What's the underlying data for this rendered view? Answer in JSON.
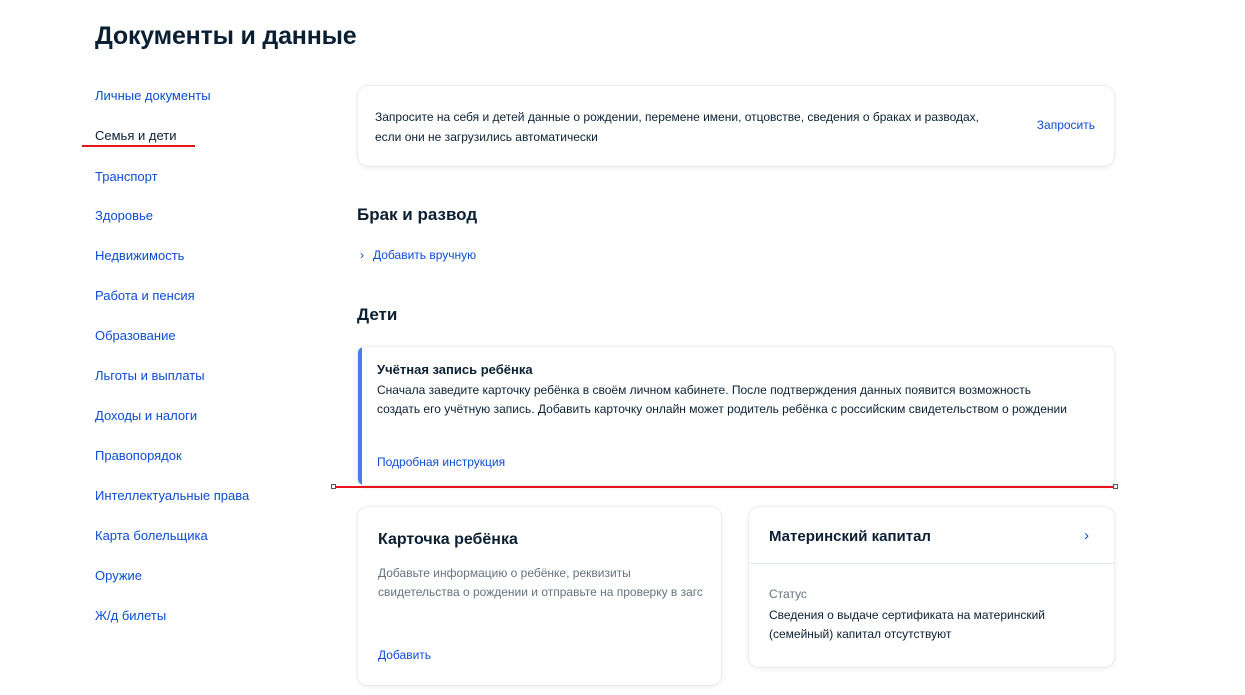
{
  "page": {
    "title": "Документы и данные"
  },
  "sidebar": {
    "items": [
      {
        "label": "Личные документы"
      },
      {
        "label": "Семья и дети",
        "active": true
      },
      {
        "label": "Транспорт"
      },
      {
        "label": "Здоровье"
      },
      {
        "label": "Недвижимость"
      },
      {
        "label": "Работа и пенсия"
      },
      {
        "label": "Образование"
      },
      {
        "label": "Льготы и выплаты"
      },
      {
        "label": "Доходы и налоги"
      },
      {
        "label": "Правопорядок"
      },
      {
        "label": "Интеллектуальные права"
      },
      {
        "label": "Карта болельщика"
      },
      {
        "label": "Оружие"
      },
      {
        "label": "Ж/д билеты"
      }
    ]
  },
  "request_banner": {
    "text": "Запросите на себя и детей данные о рождении, перемене имени, отцовстве, сведения о браках и разводах, если они не загрузились автоматически",
    "action": "Запросить"
  },
  "marriage": {
    "heading": "Брак и развод",
    "add_label": "Добавить вручную"
  },
  "children": {
    "heading": "Дети",
    "account": {
      "title": "Учётная запись ребёнка",
      "text": "Сначала заведите карточку ребёнка в своём личном кабинете. После подтверждения данных появится возможность создать его учётную запись. Добавить карточку онлайн может родитель ребёнка с российским свидетельством о рождении",
      "link": "Подробная инструкция"
    },
    "child_card": {
      "title": "Карточка ребёнка",
      "text": "Добавьте информацию о ребёнке, реквизиты свидетельства о рождении и отправьте на проверку в загс",
      "action": "Добавить"
    },
    "capital_card": {
      "title": "Материнский капитал",
      "status_label": "Статус",
      "status_text": "Сведения о выдаче сертификата на материнский (семейный) капитал отсутствуют"
    }
  },
  "colors": {
    "link": "#0d4cd3",
    "text": "#0b1f33",
    "muted": "#66727f",
    "accent": "#4b7bec",
    "annotation": "#e8141b"
  },
  "icons": {
    "add_manual": "chevron-right-icon",
    "capital": "chevron-right-icon"
  }
}
